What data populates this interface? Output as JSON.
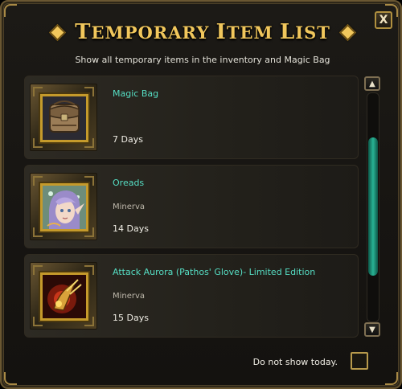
{
  "window": {
    "title_parts": [
      {
        "big": "T",
        "small": "EMPORARY "
      },
      {
        "big": "I",
        "small": "TEM "
      },
      {
        "big": "L",
        "small": "IST"
      }
    ],
    "close_label": "X",
    "subtitle": "Show all temporary items in the inventory and Magic Bag"
  },
  "items": [
    {
      "name": "Magic Bag",
      "owner": "",
      "days": "7 Days",
      "icon": "magic-bag-icon"
    },
    {
      "name": "Oreads",
      "owner": "Minerva",
      "days": "14 Days",
      "icon": "oreads-portrait-icon"
    },
    {
      "name": "Attack Aurora (Pathos' Glove)- Limited Edition",
      "owner": "Minerva",
      "days": "15 Days",
      "icon": "attack-aurora-glove-icon"
    }
  ],
  "scrollbar": {
    "up_label": "▲",
    "down_label": "▼",
    "position": 0.35
  },
  "footer": {
    "do_not_show_label": "Do not show today.",
    "checked": false
  },
  "colors": {
    "title": "#f1c75c",
    "item_name": "#56dec4",
    "scroll_thumb": "#28b394",
    "frame_gold": "#c59a2b"
  }
}
